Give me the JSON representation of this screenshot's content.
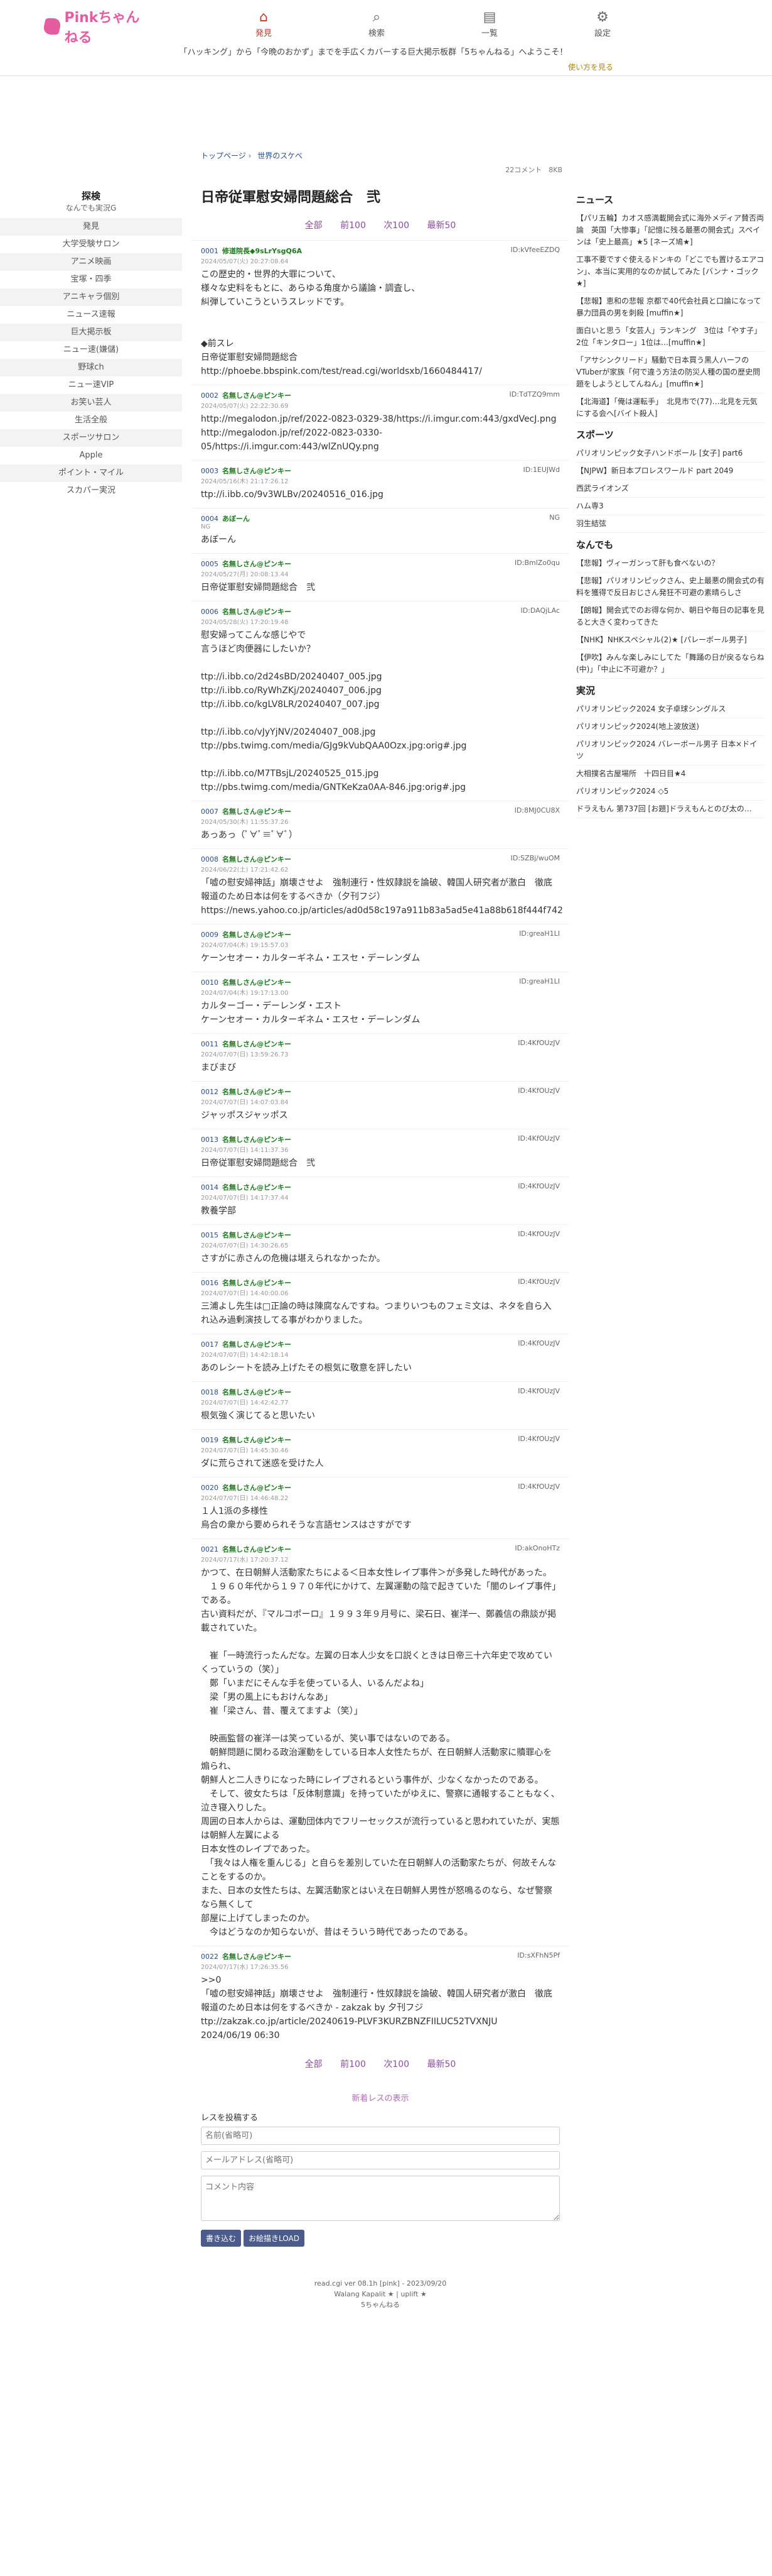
{
  "site": {
    "name": "Pinkちゃんねる"
  },
  "nav": [
    {
      "label": "発見",
      "icon": "home-icon",
      "glyph": "⌂",
      "active": true
    },
    {
      "label": "検索",
      "icon": "search-icon",
      "glyph": "⌕",
      "active": false
    },
    {
      "label": "一覧",
      "icon": "list-icon",
      "glyph": "▤",
      "active": false
    },
    {
      "label": "設定",
      "icon": "gear-icon",
      "glyph": "⚙",
      "active": false
    }
  ],
  "announce": "「ハッキング」から「今晩のおかず」までを手広くカバーする巨大掲示板群「5ちゃんねる」へようこそ！",
  "howto": "使い方を見る",
  "left": {
    "title": "探検",
    "subtitle": "なんでも実況G",
    "items": [
      "発見",
      "大学受験サロン",
      "アニメ映画",
      "宝塚・四季",
      "アニキャラ個別",
      "ニュース速報",
      "巨大掲示板",
      "ニュー速(嫌儲)",
      "野球ch",
      "ニュー速VIP",
      "お笑い芸人",
      "生活全般",
      "スポーツサロン",
      "Apple",
      "ポイント・マイル",
      "スカパー実況"
    ]
  },
  "crumb": [
    "トップページ",
    "世界のスケベ"
  ],
  "meta": {
    "comments": "22コメント",
    "size": "8KB"
  },
  "thread_title": "日帝従軍慰安婦問題総合　弐",
  "pager": [
    "全部",
    "前100",
    "次100",
    "最新50"
  ],
  "posts": [
    {
      "num": "0001",
      "name": "修道院長◆9sLrYsgQ6A",
      "date": "2024/05/07(火) 20:27:08.64",
      "id": "ID:kVfeeEZDQ",
      "body": "この歴史的・世界的大罪について、\n様々な史料をもとに、あらゆる角度から議論・調査し、\n糾弾していこうというスレッドです。\n\n\n◆前スレ\n日帝従軍慰安婦問題総合\nhttp://phoebe.bbspink.com/test/read.cgi/worldsxb/1660484417/"
    },
    {
      "num": "0002",
      "name": "名無しさん@ピンキー",
      "date": "2024/05/07(火) 22:22:30.69",
      "id": "ID:TdTZQ9mm",
      "body": "http://megalodon.jp/ref/2022-0823-0329-38/https://i.imgur.com:443/gxdVecJ.png\nhttp://megalodon.jp/ref/2022-0823-0330-05/https://i.imgur.com:443/wlZnUQy.png"
    },
    {
      "num": "0003",
      "name": "名無しさん@ピンキー",
      "date": "2024/05/16(木) 21:17:26.12",
      "id": "ID:1EUJWd",
      "body": "ttp://i.ibb.co/9v3WLBv/20240516_016.jpg"
    },
    {
      "num": "0004",
      "name": "あぼーん",
      "date": "NG",
      "id": "NG",
      "body": "あぼーん"
    },
    {
      "num": "0005",
      "name": "名無しさん@ピンキー",
      "date": "2024/05/27(月) 20:08:13.44",
      "id": "ID:BmlZo0qu",
      "body": "日帝従軍慰安婦問題総合　弐"
    },
    {
      "num": "0006",
      "name": "名無しさん@ピンキー",
      "date": "2024/05/28(火) 17:20:19.48",
      "id": "ID:DAQjLAc",
      "body": "慰安婦ってこんな感じやで\n言うほど肉便器にしたいか？\n\nttp://i.ibb.co/2d24sBD/20240407_005.jpg\nttp://i.ibb.co/RyWhZKj/20240407_006.jpg\nttp://i.ibb.co/kgLV8LR/20240407_007.jpg\n\nttp://i.ibb.co/vJyYjNV/20240407_008.jpg\nttp://pbs.twimg.com/media/GJg9kVubQAA0Ozx.jpg:orig#.jpg\n\nttp://i.ibb.co/M7TBsjL/20240525_015.jpg\nttp://pbs.twimg.com/media/GNTKeKza0AA-846.jpg:orig#.jpg"
    },
    {
      "num": "0007",
      "name": "名無しさん@ピンキー",
      "date": "2024/05/30(木) 11:55:37.26",
      "id": "ID:8MJ0CU8X",
      "body": "あっあっ（ﾟ∀ﾟ≡ﾟ∀ﾟ）"
    },
    {
      "num": "0008",
      "name": "名無しさん@ピンキー",
      "date": "2024/06/22(土) 17:21:42.62",
      "id": "ID:SZBj/wuOM",
      "body": "「嘘の慰安婦神話」崩壊させよ　強制連行・性奴隷説を論破、韓国人研究者が激白　徹底報道のため日本は何をするべきか（夕刊フジ）\nhttps://news.yahoo.co.jp/articles/ad0d58c197a911b83a5ad5e41a88b618f444f742"
    },
    {
      "num": "0009",
      "name": "名無しさん@ピンキー",
      "date": "2024/07/04(木) 19:15:57.03",
      "id": "ID:greaH1LI",
      "body": "ケーンセオー・カルターギネム・エスセ・デーレンダム"
    },
    {
      "num": "0010",
      "name": "名無しさん@ピンキー",
      "date": "2024/07/04(木) 19:17:13.00",
      "id": "ID:greaH1LI",
      "body": "カルターゴー・デーレンダ・エスト\nケーンセオー・カルターギネム・エスセ・デーレンダム"
    },
    {
      "num": "0011",
      "name": "名無しさん@ピンキー",
      "date": "2024/07/07(日) 13:59:26.73",
      "id": "ID:4KfOUzJV",
      "body": "まびまび"
    },
    {
      "num": "0012",
      "name": "名無しさん@ピンキー",
      "date": "2024/07/07(日) 14:07:03.84",
      "id": "ID:4KfOUzJV",
      "body": "ジャッポスジャッポス"
    },
    {
      "num": "0013",
      "name": "名無しさん@ピンキー",
      "date": "2024/07/07(日) 14:11:37.36",
      "id": "ID:4KfOUzJV",
      "body": "日帝従軍慰安婦問題総合　弐"
    },
    {
      "num": "0014",
      "name": "名無しさん@ピンキー",
      "date": "2024/07/07(日) 14:17:37.44",
      "id": "ID:4KfOUzJV",
      "body": "教養学部"
    },
    {
      "num": "0015",
      "name": "名無しさん@ピンキー",
      "date": "2024/07/07(日) 14:30:26.65",
      "id": "ID:4KfOUzJV",
      "body": "さすがに赤さんの危機は堪えられなかったか。"
    },
    {
      "num": "0016",
      "name": "名無しさん@ピンキー",
      "date": "2024/07/07(日) 14:40:00.06",
      "id": "ID:4KfOUzJV",
      "body": "三浦よし先生は□正論の時は陳腐なんですね。つまりいつものフェミ文は、ネタを自ら入れ込み過剰演技してる事がわかりました。"
    },
    {
      "num": "0017",
      "name": "名無しさん@ピンキー",
      "date": "2024/07/07(日) 14:42:18.14",
      "id": "ID:4KfOUzJV",
      "body": "あのレシートを読み上げたその根気に敬意を評したい"
    },
    {
      "num": "0018",
      "name": "名無しさん@ピンキー",
      "date": "2024/07/07(日) 14:42:42.77",
      "id": "ID:4KfOUzJV",
      "body": "根気強く演じてると思いたい"
    },
    {
      "num": "0019",
      "name": "名無しさん@ピンキー",
      "date": "2024/07/07(日) 14:45:30.46",
      "id": "ID:4KfOUzJV",
      "body": "ダに荒らされて迷惑を受けた人"
    },
    {
      "num": "0020",
      "name": "名無しさん@ピンキー",
      "date": "2024/07/07(日) 14:46:48.22",
      "id": "ID:4KfOUzJV",
      "body": "１人1派の多様性\n烏合の衆から要められそうな言語センスはさすがです"
    },
    {
      "num": "0021",
      "name": "名無しさん@ピンキー",
      "date": "2024/07/17(水) 17:20:37.12",
      "id": "ID:akOnoHTz",
      "body": "かつて、在日朝鮮人活動家たちによる＜日本女性レイプ事件＞が多発した時代があった。\n　１９６０年代から１９７０年代にかけて、左翼運動の陰で起きていた「闇のレイプ事件」である。\n古い資料だが、『マルコポーロ』１９９３年９月号に、梁石日、崔洋一、鄭義信の鼎談が掲載されていた。\n\n　崔「一時流行ったんだな。左翼の日本人少女を口説くときは日帝三十六年史で攻めていくっていうの（笑）」\n　鄭「いまだにそんな手を使っている人、いるんだよね」\n　梁「男の風上にもおけんなあ」\n　崔「梁さん、昔、覆えてますよ（笑）」\n\n　映画監督の崔洋一は笑っているが、笑い事ではないのである。\n　朝鮮問題に関わる政治運動をしている日本人女性たちが、在日朝鮮人活動家に贖罪心を煽られ、\n朝鮮人と二人きりになった時にレイプされるという事件が、少なくなかったのである。\n　そして、彼女たちは「反体制意識」を持っていたがゆえに、警察に通報することもなく、泣き寝入りした。\n周囲の日本人からは、運動団体内でフリーセックスが流行っていると思われていたが、実態は朝鮮人左翼による\n日本女性のレイプであった。\n　「我々は人権を重んじる」と自らを差別していた在日朝鮮人の活動家たちが、何故そんなことをするのか。\nまた、日本の女性たちは、左翼活動家とはいえ在日朝鮮人男性が怒鳴るのなら、なぜ警察なら無くして\n部屋に上げてしまったのか。\n　今はどうなのか知らないが、昔はそういう時代であったのである。"
    },
    {
      "num": "0022",
      "name": "名無しさん@ピンキー",
      "date": "2024/07/17(水) 17:26:35.56",
      "id": "ID:sXFhN5Pf",
      "body": ">>0\n「嘘の慰安婦神話」崩壊させよ　強制連行・性奴隷説を論破、韓国人研究者が激白　徹底報道のため日本は何をするべきか - zakzak by 夕刊フジ\nttp://zakzak.co.jp/article/20240619-PLVF3KURZBNZFIILUC52TVXNJU\n2024/06/19 06:30"
    }
  ],
  "form": {
    "title": "新着レスの表示",
    "label": "レスを投稿する",
    "name_placeholder": "名前(省略可)",
    "mail_placeholder": "メールアドレス(省略可)",
    "body_placeholder": "コメント内容",
    "submit": "書き込む",
    "draw": "お絵描きLOAD"
  },
  "footer": [
    "read.cgi ver 08.1h [pink] - 2023/09/20",
    "Walang Kapalit ★ | uplift ★",
    "5ちゃんねる"
  ],
  "right": {
    "news_title": "ニュース",
    "news": [
      "【パリ五輪】カオス感満載開会式に海外メディア賛否両論　英国「大惨事」「記憶に残る最悪の開会式」スペインは「史上最高」★5 [ネーズ鳩★]",
      "工事不要ですぐ使えるドンキの「どこでも置けるエアコン」、本当に実用的なのか試してみた [バンナ・ゴック★]",
      "【悲報】恵和の悲報 京都で40代会社員と口論になって暴力団員の男を刺殺 [muffin★]",
      "面白いと思う「女芸人」ランキング　3位は「やす子」2位「キンタロー」1位は…[muffin★]",
      "「アサシンクリード」騒動で日本買う黒人ハーフのVTuberが家族「何で違う方法の防災人種の国の歴史問題をしようとしてんねん」[muffin★]",
      "【北海道】「俺は運転手」　北見市で(77)…北見を元気にする会へ[バイト殺人]"
    ],
    "sports_title": "スポーツ",
    "sports": [
      "パリオリンピック女子ハンドボール [女子] part6",
      "【NJPW】新日本プロレスワールド part 2049",
      "西武ライオンズ",
      "ハム専3",
      "羽生結弦"
    ],
    "nandemo_title": "なんでも",
    "nandemo": [
      "【悲報】ヴィーガンって肝も食べないの？",
      "【悲報】パリオリンピックさん、史上最悪の開会式の有料を獲得で反日おじさん発狂不可避の素晴らしさ",
      "【朗報】開会式でのお得な何か、朝日や毎日の記事を見ると大きく変わってきた",
      "【NHK】NHKスペシャル(2)★ [パレーボール男子]",
      "【伊吹】みんな楽しみにしてた「舞踊の日が戻るならね(中)」「中止に不可避か？」"
    ],
    "live_title": "実況",
    "live": [
      "パリオリンピック2024 女子卓球シングルス",
      "パリオリンピック2024(地上波放送)",
      "パリオリンピック2024 バレーボール男子 日本×ドイツ",
      "大相撲名古屋場所　十四日目★4",
      "パリオリンピック2024 ◇5",
      "ドラえもん 第737回 [お題]ドラえもんとのび太の…"
    ]
  }
}
